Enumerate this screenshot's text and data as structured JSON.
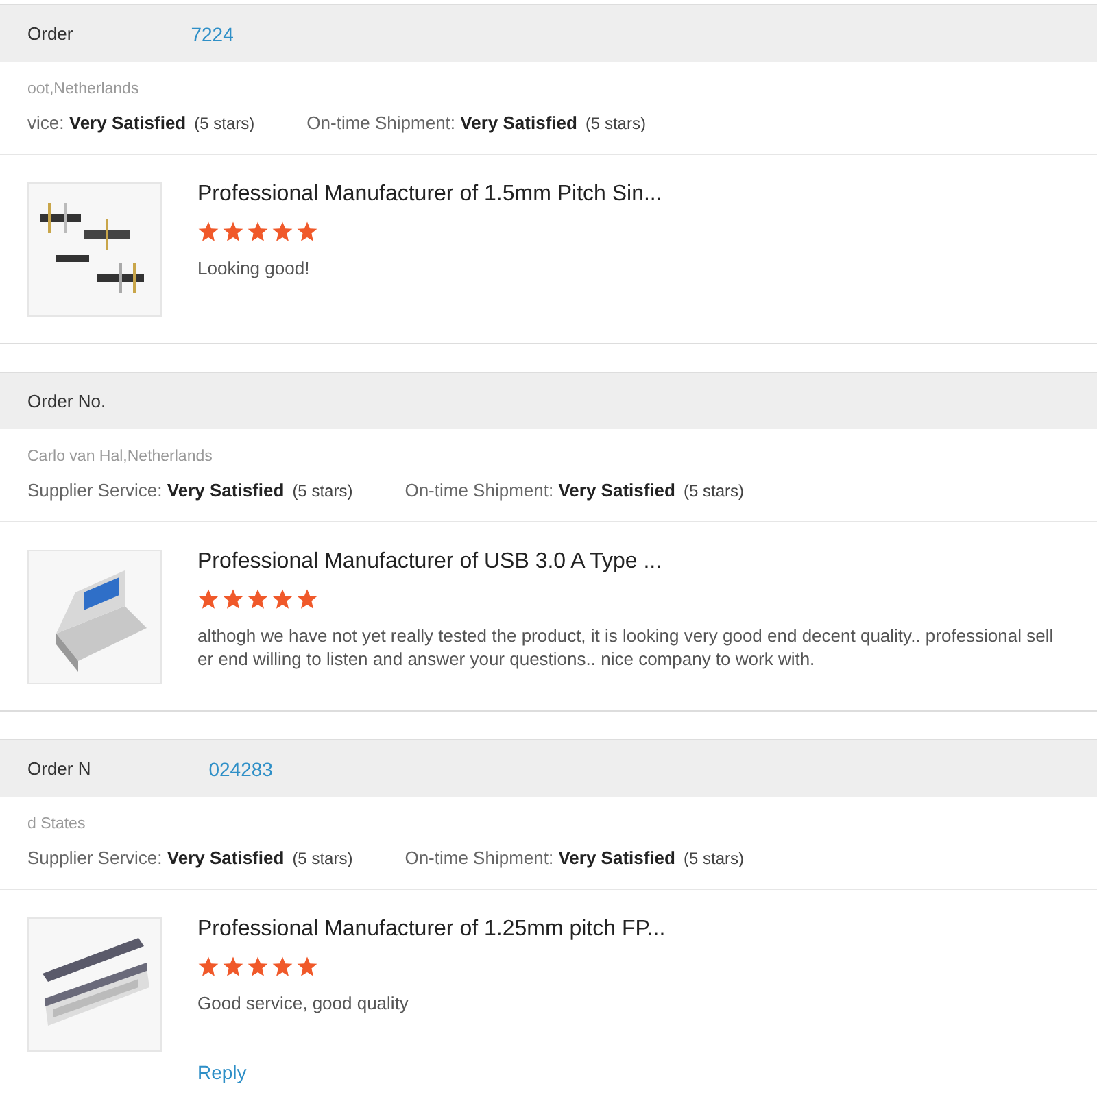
{
  "reviews": [
    {
      "order_label": "Order",
      "order_number": "7224",
      "location": "oot,Netherlands",
      "ratings": [
        {
          "label": "vice:",
          "value": "Very Satisfied",
          "note": "(5 stars)"
        },
        {
          "label": "On-time Shipment:",
          "value": "Very Satisfied",
          "note": "(5 stars)"
        }
      ],
      "product": {
        "title": "Professional Manufacturer of 1.5mm Pitch Sin...",
        "stars": 5,
        "comment": "Looking good!"
      }
    },
    {
      "order_label": "Order No.",
      "location": "Carlo van Hal,Netherlands",
      "ratings": [
        {
          "label": "Supplier Service:",
          "value": "Very Satisfied",
          "note": "(5 stars)"
        },
        {
          "label": "On-time Shipment:",
          "value": "Very Satisfied",
          "note": "(5 stars)"
        }
      ],
      "product": {
        "title": "Professional Manufacturer of USB 3.0 A Type ...",
        "stars": 5,
        "comment": "althogh we have not yet really tested the product, it is looking very good end decent quality.. professional seller end willing to listen and answer your questions.. nice company to work with."
      }
    },
    {
      "order_label": "Order N",
      "order_number": "024283",
      "location": "d States",
      "ratings": [
        {
          "label": "Supplier Service:",
          "value": "Very Satisfied",
          "note": "(5 stars)"
        },
        {
          "label": "On-time Shipment:",
          "value": "Very Satisfied",
          "note": "(5 stars)"
        }
      ],
      "product": {
        "title": "Professional Manufacturer of 1.25mm pitch FP...",
        "stars": 5,
        "comment": "Good service, good quality",
        "reply": "Reply"
      }
    }
  ]
}
